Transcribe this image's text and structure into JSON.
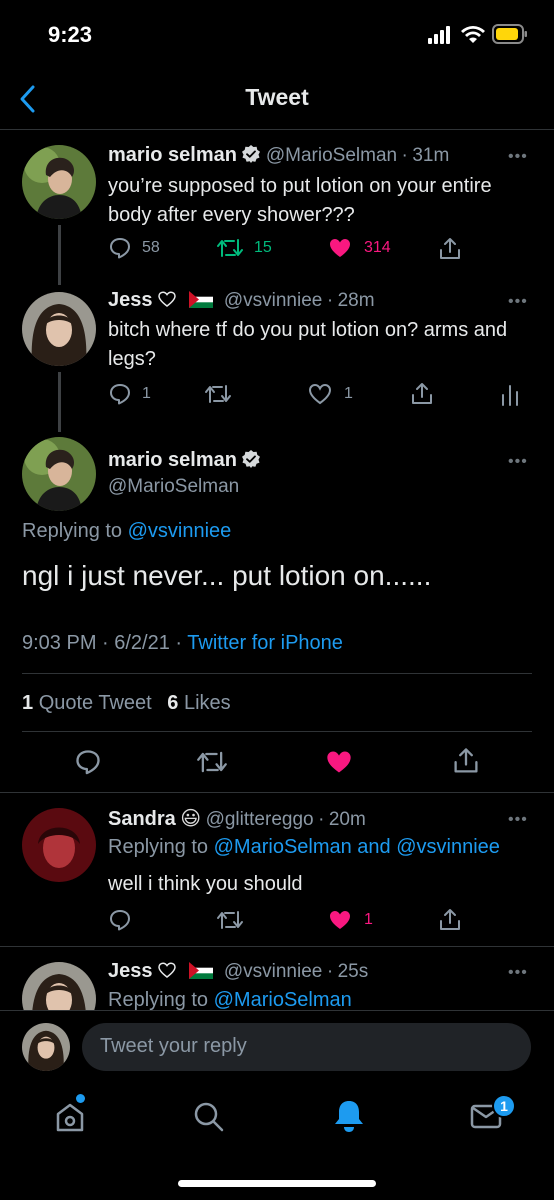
{
  "status": {
    "time": "9:23"
  },
  "header": {
    "title": "Tweet"
  },
  "tweets": [
    {
      "name": "mario selman",
      "verified": true,
      "handle": "@MarioSelman",
      "time": "31m",
      "text": "you’re supposed to put lotion on your entire body after every shower???",
      "replies": "58",
      "retweets": "15",
      "likes": "314"
    },
    {
      "name": "Jess",
      "handle": "@vsvinniee",
      "time": "28m",
      "text": "bitch where tf do you put lotion on? arms and legs?",
      "replies": "1",
      "likes": "1"
    }
  ],
  "main_tweet": {
    "name": "mario selman",
    "handle": "@MarioSelman",
    "replying_prefix": "Replying to ",
    "replying_to": "@vsvinniee",
    "text": "ngl i just never... put lotion on......",
    "datetime": "9:03 PM · 6/2/21 · ",
    "source": "Twitter for iPhone",
    "quote_count": "1",
    "quote_label": "Quote Tweet",
    "like_count": "6",
    "like_label": "Likes"
  },
  "replies": [
    {
      "name": "Sandra",
      "emoji": "😃",
      "handle": "@glittereggo",
      "time": "20m",
      "replying_prefix": "Replying to ",
      "replying_to": "@MarioSelman and @vsvinniee",
      "text": "well i think you should",
      "likes": "1"
    },
    {
      "name": "Jess",
      "handle": "@vsvinniee",
      "time": "25s",
      "replying_prefix": "Replying to ",
      "replying_to": "@MarioSelman"
    }
  ],
  "reply_bar": {
    "placeholder": "Tweet your reply"
  },
  "tabbar": {
    "messages_badge": "1"
  },
  "colors": {
    "accent": "#1d9bf0",
    "like": "#f91880",
    "retweet": "#00ba7c",
    "background": "#000000"
  }
}
